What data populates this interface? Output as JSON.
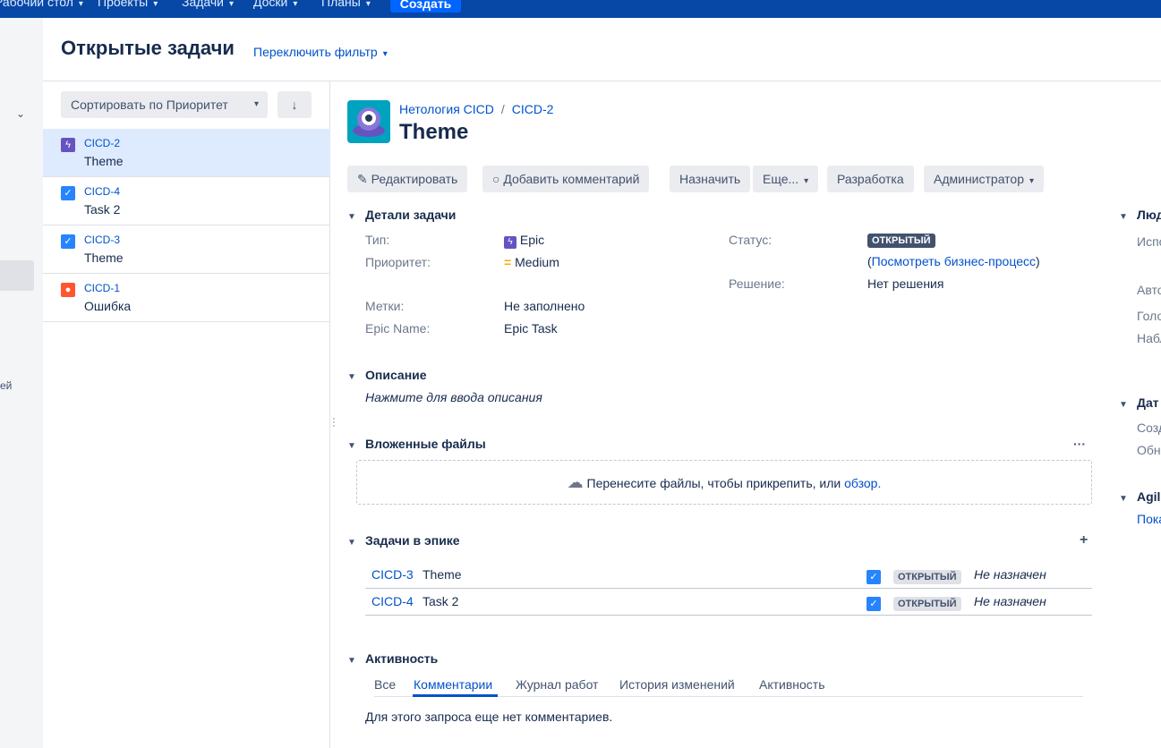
{
  "topnav": {
    "items": [
      "Рабочий стол",
      "Проекты",
      "Задачи",
      "Доски",
      "Планы"
    ],
    "create": "Создать"
  },
  "sidebar": {
    "partial_text": "ей"
  },
  "header": {
    "title": "Открытые задачи",
    "switch_filter": "Переключить фильтр"
  },
  "list": {
    "sort_label": "Сортировать по Приоритет",
    "issues": [
      {
        "key": "CICD-2",
        "summary": "Theme",
        "type": "epic",
        "active": true
      },
      {
        "key": "CICD-4",
        "summary": "Task 2",
        "type": "task",
        "active": false
      },
      {
        "key": "CICD-3",
        "summary": "Theme",
        "type": "task",
        "active": false
      },
      {
        "key": "CICD-1",
        "summary": "Ошибка",
        "type": "bug",
        "active": false
      }
    ]
  },
  "issue": {
    "project": "Нетология CICD",
    "key": "CICD-2",
    "title": "Theme",
    "toolbar": {
      "edit": "Редактировать",
      "comment": "Добавить комментарий",
      "assign": "Назначить",
      "more": "Еще...",
      "dev": "Разработка",
      "admin": "Администратор"
    },
    "details": {
      "heading": "Детали задачи",
      "type_label": "Тип:",
      "type_value": "Epic",
      "priority_label": "Приоритет:",
      "priority_value": "Medium",
      "labels_label": "Метки:",
      "labels_value": "Не заполнено",
      "epic_name_label": "Epic Name:",
      "epic_name_value": "Epic Task",
      "status_label": "Статус:",
      "status_value": "ОТКРЫТЫЙ",
      "workflow_prefix": "(",
      "workflow_link": "Посмотреть бизнес-процесс",
      "workflow_suffix": ")",
      "resolution_label": "Решение:",
      "resolution_value": "Нет решения"
    },
    "description": {
      "heading": "Описание",
      "placeholder": "Нажмите для ввода описания"
    },
    "attachments": {
      "heading": "Вложенные файлы",
      "drop_text": "Перенесите файлы, чтобы прикрепить, или",
      "browse": "обзор."
    },
    "epic_tasks": {
      "heading": "Задачи в эпике",
      "rows": [
        {
          "key": "CICD-3",
          "summary": "Theme",
          "status": "ОТКРЫТЫЙ",
          "assignee": "Не назначен"
        },
        {
          "key": "CICD-4",
          "summary": "Task 2",
          "status": "ОТКРЫТЫЙ",
          "assignee": "Не назначен"
        }
      ]
    },
    "activity": {
      "heading": "Активность",
      "tabs": [
        "Все",
        "Комментарии",
        "Журнал работ",
        "История изменений",
        "Активность"
      ],
      "active_tab": "Комментарии",
      "empty": "Для этого запроса еще нет комментариев."
    }
  },
  "right_column": {
    "people_heading": "Люд",
    "people_labels": [
      "Испо",
      "Авто",
      "Голо",
      "Набл"
    ],
    "dates_heading": "Дат",
    "dates_labels": [
      "Созд",
      "Обн"
    ],
    "agile_heading": "Agil",
    "agile_link": "Пока"
  }
}
